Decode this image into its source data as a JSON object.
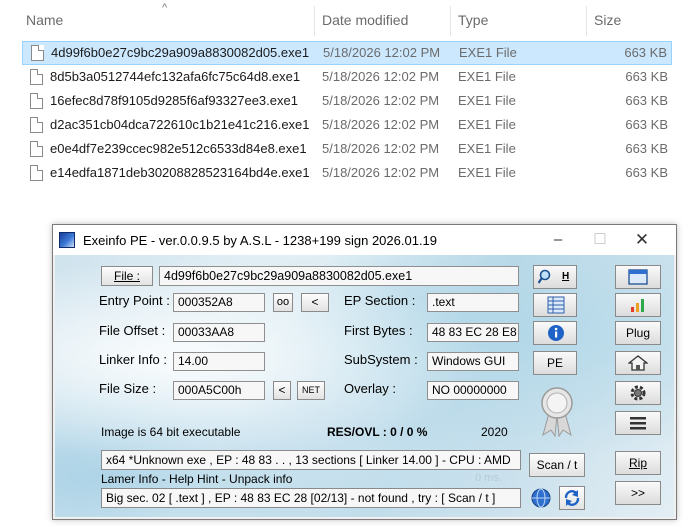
{
  "explorer": {
    "headers": {
      "name": "Name",
      "date": "Date modified",
      "type": "Type",
      "size": "Size"
    },
    "sort_indicator": "^",
    "files": [
      {
        "name": "4d99f6b0e27c9bc29a909a8830082d05.exe1",
        "date": "5/18/2026 12:02 PM",
        "type": "EXE1 File",
        "size": "663 KB",
        "selected": true
      },
      {
        "name": "8d5b3a0512744efc132afa6fc75c64d8.exe1",
        "date": "5/18/2026 12:02 PM",
        "type": "EXE1 File",
        "size": "663 KB"
      },
      {
        "name": "16efec8d78f9105d9285f6af93327ee3.exe1",
        "date": "5/18/2026 12:02 PM",
        "type": "EXE1 File",
        "size": "663 KB"
      },
      {
        "name": "d2ac351cb04dca722610c1b21e41c216.exe1",
        "date": "5/18/2026 12:02 PM",
        "type": "EXE1 File",
        "size": "663 KB"
      },
      {
        "name": "e0e4df7e239ccec982e512c6533d84e8.exe1",
        "date": "5/18/2026 12:02 PM",
        "type": "EXE1 File",
        "size": "663 KB"
      },
      {
        "name": "e14edfa1871deb30208828523164bd4e.exe1",
        "date": "5/18/2026 12:02 PM",
        "type": "EXE1 File",
        "size": "663 KB"
      }
    ]
  },
  "exeinfo": {
    "title": "Exeinfo PE - ver.0.0.9.5  by A.S.L -  1238+199 sign  2026.01.19",
    "file_button": "File :",
    "file_value": "4d99f6b0e27c9bc29a909a8830082d05.exe1",
    "labels": {
      "entry_point": "Entry Point :",
      "file_offset": "File Offset :",
      "linker_info": "Linker Info :",
      "file_size": "File Size :",
      "ep_section": "EP Section :",
      "first_bytes": "First Bytes :",
      "subsystem": "SubSystem :",
      "overlay": "Overlay :"
    },
    "values": {
      "entry_point": "000352A8",
      "file_offset": "00033AA8",
      "linker_info": "14.00",
      "file_size": "000A5C00h",
      "ep_section": ".text",
      "first_bytes": "48 83 EC 28 E8",
      "subsystem": "Windows GUI",
      "overlay": "NO  00000000"
    },
    "small_buttons": {
      "oo": "oo",
      "arrow_left_1": "<",
      "arrow_left_2": "<",
      "net": "NET",
      "hex_search": "H",
      "pe": "PE",
      "plug": "Plug",
      "scan": "Scan / t",
      "rip": "Rip",
      "next": ">>"
    },
    "image_info": "Image is 64 bit executable",
    "res_ovl": "RES/OVL : 0 / 0 %",
    "year": "2020",
    "detect_line": "x64 *Unknown exe , EP : 48 83 . . , 13 sections  [ Linker 14.00 ] - CPU : AMD",
    "lamer_info": "Lamer Info - Help Hint - Unpack info",
    "timing": "0 ms.",
    "hint_line": "Big sec. 02 [ .text ] , EP : 48 83 EC 28 [02/13] - not found , try : [ Scan / t ]"
  },
  "colors": {
    "selection": "#cce8ff",
    "selection_border": "#99d1ff",
    "window_background": "#f0f0f0",
    "client_background": "#cfe3ee"
  }
}
